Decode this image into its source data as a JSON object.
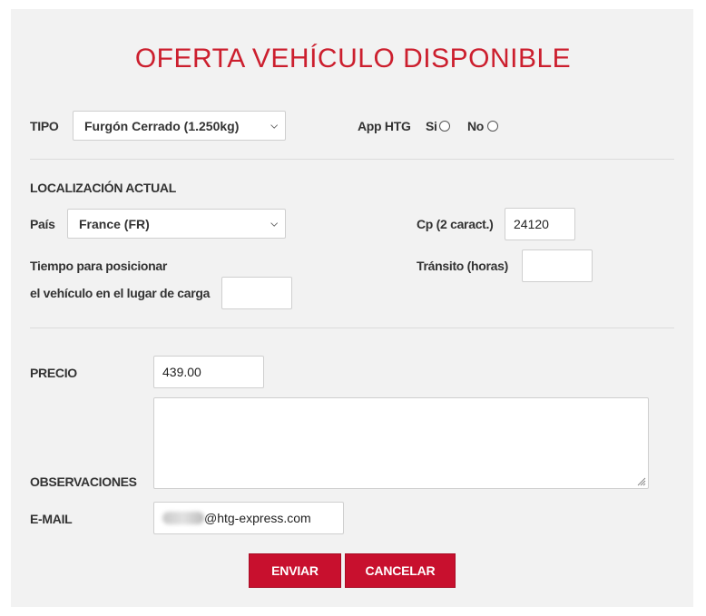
{
  "title": "OFERTA VEHÍCULO DISPONIBLE",
  "tipo": {
    "label": "TIPO",
    "value": "Furgón Cerrado (1.250kg)"
  },
  "app_htg": {
    "label": "App HTG",
    "si": "Si",
    "no": "No"
  },
  "localizacion": {
    "heading": "LOCALIZACIÓN ACTUAL",
    "pais_label": "País",
    "pais_value": "France (FR)",
    "cp_label": "Cp (2 caract.)",
    "cp_value": "24120",
    "tiempo_label_1": "Tiempo para posicionar",
    "tiempo_label_2": "el vehículo en el lugar de carga",
    "tiempo_value": "",
    "transito_label": "Tránsito (horas)",
    "transito_value": ""
  },
  "precio": {
    "label": "PRECIO",
    "value": "439.00"
  },
  "observaciones": {
    "label": "OBSERVACIONES",
    "value": ""
  },
  "email": {
    "label": "E-MAIL",
    "domain": "@htg-express.com"
  },
  "buttons": {
    "enviar": "ENVIAR",
    "cancelar": "CANCELAR"
  },
  "colors": {
    "accent": "#c8102e",
    "title": "#cc1f2e",
    "panel": "#f2f2f2"
  }
}
